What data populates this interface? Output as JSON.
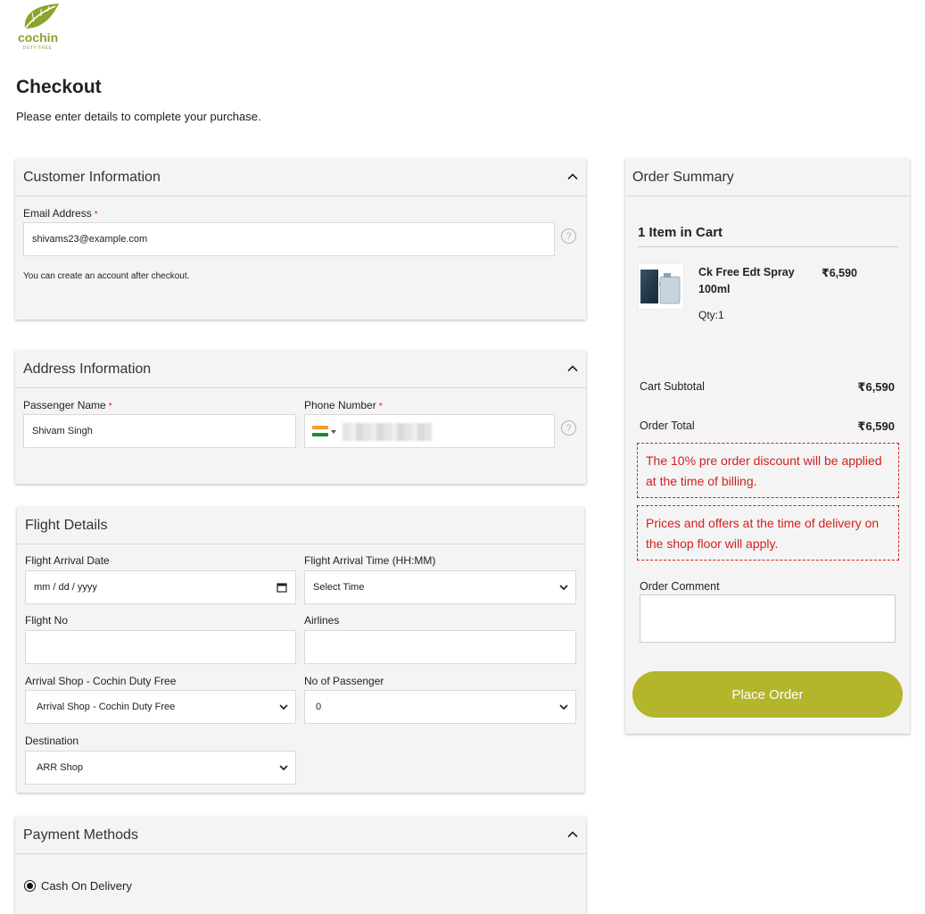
{
  "brand": {
    "name": "cochin",
    "sub": "DUTY FREE",
    "color": "#8aa52c"
  },
  "page": {
    "title": "Checkout",
    "subtitle": "Please enter details to complete your purchase."
  },
  "customer": {
    "heading": "Customer Information",
    "email_label": "Email Address",
    "required_mark": "*",
    "email_value": "shivams23@example.com",
    "help_glyph": "?",
    "note": "You can create an account after checkout."
  },
  "address": {
    "heading": "Address Information",
    "name_label": "Passenger Name",
    "name_value": "Shivam Singh",
    "phone_label": "Phone Number"
  },
  "flight": {
    "heading": "Flight Details",
    "date_label": "Flight Arrival Date",
    "date_placeholder": "mm / dd / yyyy",
    "time_label": "Flight Arrival Time (HH:MM)",
    "time_value": "Select Time",
    "flight_no_label": "Flight No",
    "airlines_label": "Airlines",
    "shop_label": "Arrival Shop - Cochin Duty Free",
    "shop_value": "Arrival Shop - Cochin Duty Free",
    "passengers_label": "No of Passenger",
    "passengers_value": "0",
    "destination_label": "Destination",
    "destination_value": "ARR Shop"
  },
  "payment": {
    "heading": "Payment Methods",
    "option": "Cash On Delivery"
  },
  "summary": {
    "heading": "Order Summary",
    "items_in_cart": "1 Item in Cart",
    "product_name": "Ck Free Edt Spray 100ml",
    "product_price": "₹6,590",
    "qty": "Qty:1",
    "subtotal_label": "Cart Subtotal",
    "subtotal_value": "₹6,590",
    "total_label": "Order Total",
    "total_value": "₹6,590",
    "notice1": "The 10% pre order discount will be applied at the time of billing.",
    "notice2": "Prices and offers at the time of delivery on the shop floor will apply.",
    "comment_label": "Order Comment",
    "place_order": "Place Order",
    "button_color": "#b3b52b",
    "notice_color": "#d32020"
  }
}
